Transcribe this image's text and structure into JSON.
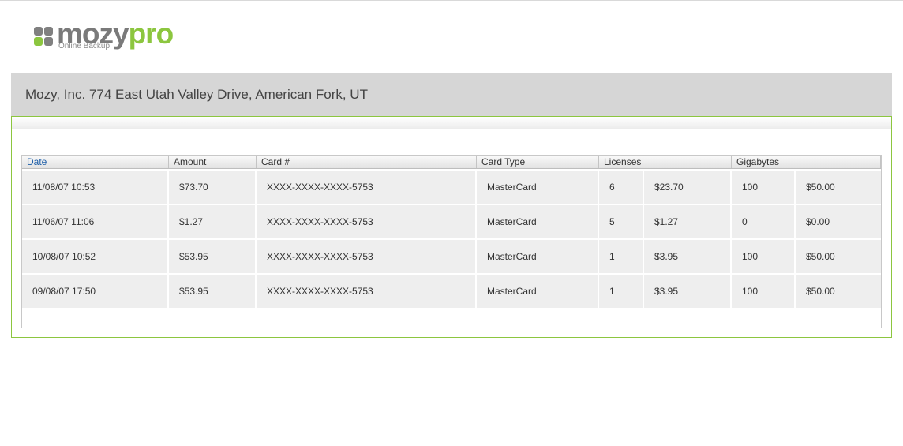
{
  "brand": {
    "logo_word_main": "mozy",
    "logo_word_accent": "pro",
    "tagline": "Online Backup",
    "colors": {
      "gray": "#7a7a7a",
      "green": "#8cc63f"
    }
  },
  "company": {
    "address": "Mozy, Inc. 774 East Utah Valley Drive, American Fork, UT"
  },
  "table": {
    "columns": [
      "Date",
      "Amount",
      "Card #",
      "Card Type",
      "Licenses",
      "Gigabytes"
    ],
    "sorted_column": "Date",
    "rows": [
      [
        "11/08/07 10:53",
        "$73.70",
        "XXXX-XXXX-XXXX-5753",
        "MasterCard",
        "6",
        "$23.70",
        "100",
        "$50.00"
      ],
      [
        "11/06/07 11:06",
        "$1.27",
        "XXXX-XXXX-XXXX-5753",
        "MasterCard",
        "5",
        "$1.27",
        "0",
        "$0.00"
      ],
      [
        "10/08/07 10:52",
        "$53.95",
        "XXXX-XXXX-XXXX-5753",
        "MasterCard",
        "1",
        "$3.95",
        "100",
        "$50.00"
      ],
      [
        "09/08/07 17:50",
        "$53.95",
        "XXXX-XXXX-XXXX-5753",
        "MasterCard",
        "1",
        "$3.95",
        "100",
        "$50.00"
      ]
    ]
  }
}
